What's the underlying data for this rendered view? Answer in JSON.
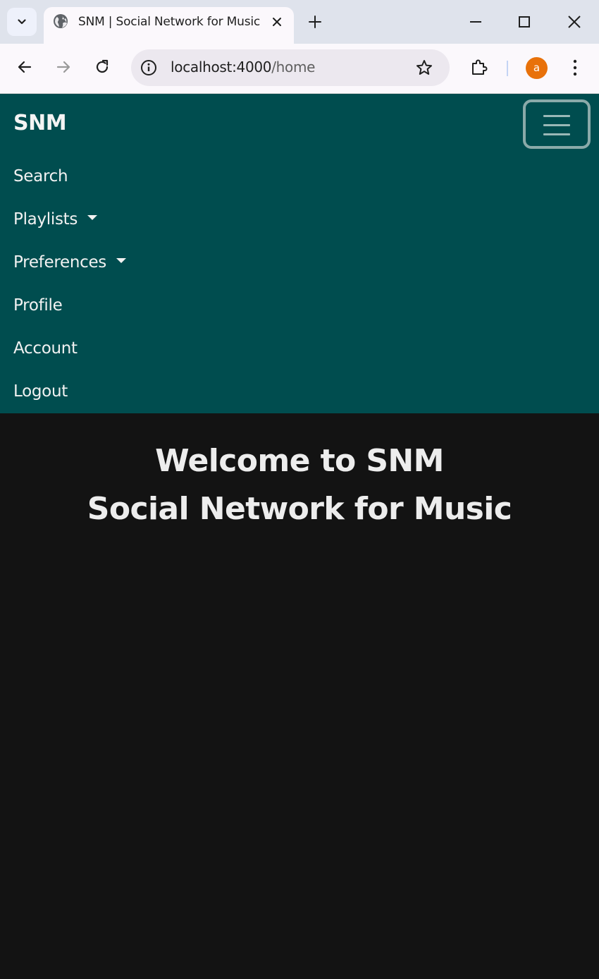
{
  "browser": {
    "tab": {
      "title": "SNM | Social Network for Music"
    },
    "address": {
      "host": "localhost:4000",
      "path": "/home"
    },
    "profile_initial": "a",
    "accent_color": "#e8710a"
  },
  "navbar": {
    "brand": "SNM",
    "items": [
      {
        "label": "Search",
        "dropdown": false
      },
      {
        "label": "Playlists",
        "dropdown": true
      },
      {
        "label": "Preferences",
        "dropdown": true
      },
      {
        "label": "Profile",
        "dropdown": false
      },
      {
        "label": "Account",
        "dropdown": false
      },
      {
        "label": "Logout",
        "dropdown": false
      }
    ],
    "background_color": "#004d4f"
  },
  "main": {
    "title_line1": "Welcome to SNM",
    "title_line2": "Social Network for Music",
    "background_color": "#131313"
  }
}
